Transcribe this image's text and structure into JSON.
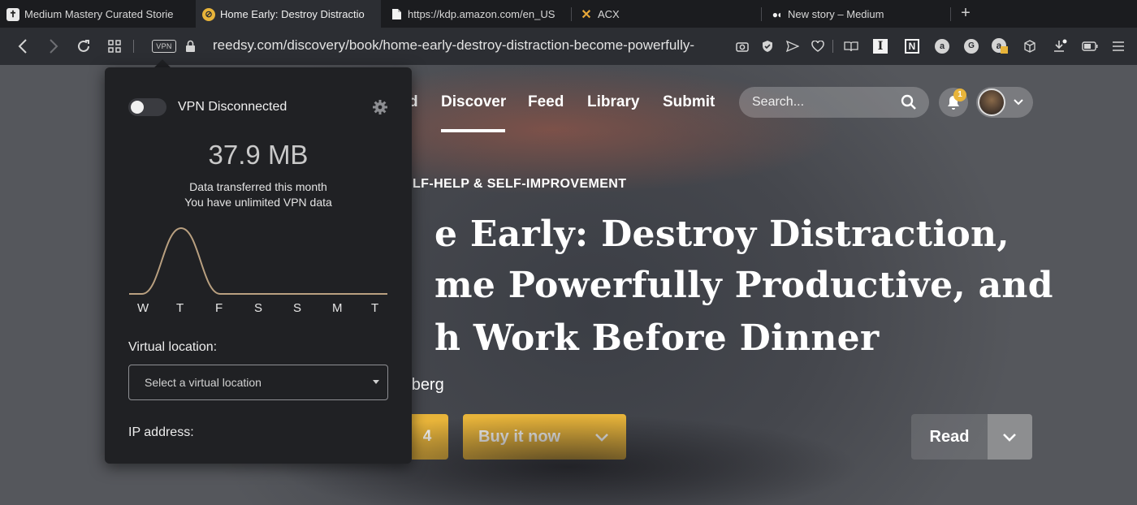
{
  "tabs": [
    {
      "title": "Medium Mastery Curated Storie",
      "icon": "medium-mastery-icon"
    },
    {
      "title": "Home Early: Destroy Distractio",
      "icon": "reedsy-icon",
      "active": true
    },
    {
      "title": "https://kdp.amazon.com/en_US",
      "icon": "document-icon"
    },
    {
      "title": "ACX",
      "icon": "acx-icon"
    },
    {
      "title": "New story – Medium",
      "icon": "medium-icon"
    }
  ],
  "toolbar": {
    "vpn_badge": "VPN",
    "url": "reedsy.com/discovery/book/home-early-destroy-distraction-become-powerfully-"
  },
  "site": {
    "nav": {
      "partial": "d",
      "discover": "Discover",
      "feed": "Feed",
      "library": "Library",
      "submit": "Submit"
    },
    "search_placeholder": "Search...",
    "notification_count": "1",
    "accent": "#e8b43a"
  },
  "book": {
    "category": "LF-HELP & SELF-IMPROVEMENT",
    "title_lines": [
      "e Early: Destroy Distraction,",
      "me Powerfully Productive, and",
      "h Work Before Dinner"
    ],
    "author": "ehlberg",
    "price_fragment": "4",
    "buy_label": "Buy it now",
    "read_label": "Read"
  },
  "vpn": {
    "status": "VPN Disconnected",
    "enabled": false,
    "data_amount": "37.9 MB",
    "data_caption": "Data transferred this month",
    "data_note": "You have unlimited VPN data",
    "days": [
      "W",
      "T",
      "F",
      "S",
      "S",
      "M",
      "T"
    ],
    "usage_shape": [
      0,
      1,
      0,
      0,
      0,
      0,
      0
    ],
    "location_label": "Virtual location:",
    "location_placeholder": "Select a virtual location",
    "ip_label": "IP address:"
  }
}
